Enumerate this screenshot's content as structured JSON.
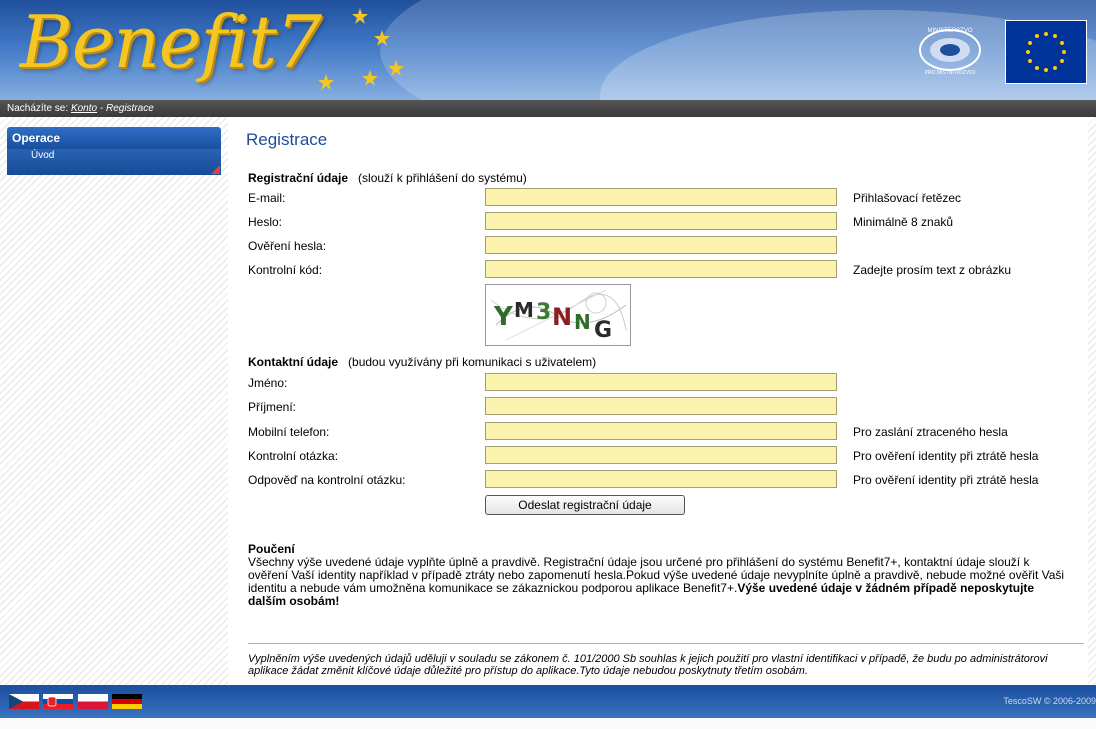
{
  "header": {
    "logo_text": "Benefit7",
    "ministry_logo_text": "MINISTERSTVO PRO MÍSTNÍ ROZVOJ"
  },
  "breadcrumb": {
    "prefix": "Nacházíte se:",
    "link": "Konto",
    "separator": " - ",
    "current": "Registrace"
  },
  "sidebar": {
    "heading": "Operace",
    "items": [
      {
        "label": "Úvod"
      }
    ]
  },
  "page": {
    "title": "Registrace",
    "registration_section": {
      "title": "Registrační údaje",
      "note": "(slouží k přihlášení do systému)",
      "fields": [
        {
          "label": "E-mail:",
          "value": "",
          "hint": "Přihlašovací řetězec"
        },
        {
          "label": "Heslo:",
          "value": "",
          "hint": "Minimálně 8 znaků"
        },
        {
          "label": "Ověření hesla:",
          "value": "",
          "hint": ""
        },
        {
          "label": "Kontrolní kód:",
          "value": "",
          "hint": "Zadejte prosím text z obrázku"
        }
      ]
    },
    "captcha_text": "YM3NNG",
    "contact_section": {
      "title": "Kontaktní údaje",
      "note": "(budou využívány při komunikaci s uživatelem)",
      "fields": [
        {
          "label": "Jméno:",
          "value": "",
          "hint": ""
        },
        {
          "label": "Příjmení:",
          "value": "",
          "hint": ""
        },
        {
          "label": "Mobilní telefon:",
          "value": "",
          "hint": "Pro zaslání ztraceného hesla"
        },
        {
          "label": "Kontrolní otázka:",
          "value": "",
          "hint": "Pro ověření identity při ztrátě hesla"
        },
        {
          "label": "Odpověď na kontrolní otázku:",
          "value": "",
          "hint": "Pro ověření identity při ztrátě hesla"
        }
      ]
    },
    "submit_label": "Odeslat registrační údaje",
    "notice": {
      "title": "Poučení",
      "body": "Všechny výše uvedené údaje vyplňte úplně a pravdivě. Registrační údaje jsou určené pro přihlášení do systému Benefit7+, kontaktní údaje slouží k ověření Vaší identity například v případě ztráty nebo zapomenutí hesla.Pokud výše uvedené údaje nevyplníte úplně a pravdivě, nebude možné ověřit Vaši identitu a nebude vám umožněna komunikace se zákaznickou podporou aplikace Benefit7+.",
      "bold": "Výše uvedené údaje v žádném případě neposkytujte dalším osobám!"
    },
    "consent": "Vyplněním výše uvedených údajů uděluji v souladu se zákonem č. 101/2000 Sb souhlas k jejich použití pro vlastní identifikaci v případě, že budu po administrátorovi aplikace žádat změnit klíčové údaje důležité pro přístup do aplikace.Tyto údaje nebudou poskytnuty třetím osobám."
  },
  "footer": {
    "flags": [
      "flag-cz-icon",
      "flag-sk-icon",
      "flag-pl-icon",
      "flag-de-icon"
    ],
    "copyright": "TescoSW © 2006-2009"
  },
  "colors": {
    "accent": "#1d4b9b",
    "input_bg": "#fbf2ae",
    "logo_gold": "#f3c623"
  }
}
